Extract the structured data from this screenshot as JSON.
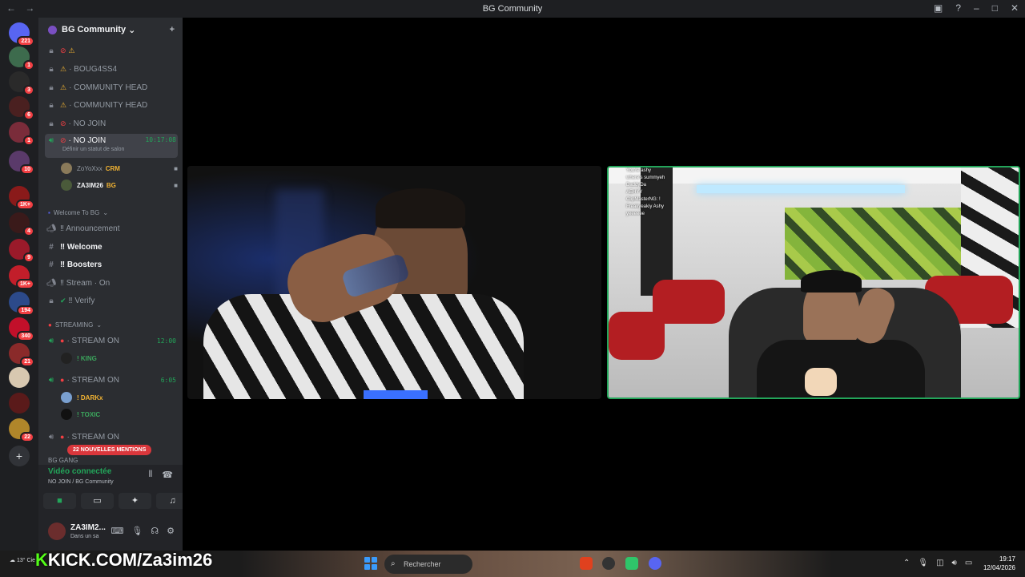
{
  "titlebar": {
    "title": "BG Community",
    "back": "←",
    "forward": "→"
  },
  "servers": [
    {
      "badge": "221"
    },
    {
      "badge": "1"
    },
    {
      "badge": "3"
    },
    {
      "badge": "6"
    },
    {
      "badge": "1"
    },
    {
      "badge": "10"
    },
    {
      "badge": "1K+"
    },
    {
      "badge": "4"
    },
    {
      "badge": "9"
    },
    {
      "badge": "1K+"
    },
    {
      "badge": "194"
    },
    {
      "badge": "340"
    },
    {
      "badge": "21"
    },
    {
      "badge": ""
    },
    {
      "badge": ""
    },
    {
      "badge": "22"
    }
  ],
  "guild": {
    "name": "BG Community"
  },
  "channels": [
    {
      "name": "·",
      "kind": "warn"
    },
    {
      "name": "· BOUG4SS4",
      "kind": "warn"
    },
    {
      "name": "· COMMUNITY HEAD",
      "kind": "warn"
    },
    {
      "name": "· COMMUNITY HEAD",
      "kind": "warn"
    },
    {
      "name": "· NO JOIN",
      "kind": "nojoin"
    }
  ],
  "active_channel": {
    "name": "· NO JOIN",
    "time": "10:17:08",
    "status": "Définir un statut de salon"
  },
  "voice_users_1": [
    {
      "name": "ZoYoXxx",
      "tag": "CRM"
    },
    {
      "name": "ZA3IM26",
      "tag": "BG"
    }
  ],
  "category_welcome": "Welcome To BG",
  "welcome_channels": [
    {
      "name": "‼ Announcement",
      "bold": false
    },
    {
      "name": "‼ Welcome",
      "bold": true
    },
    {
      "name": "‼ Boosters",
      "bold": true
    },
    {
      "name": "‼ Stream · On",
      "bold": false
    },
    {
      "name": "‼ Verify",
      "bold": false
    }
  ],
  "category_streaming": "STREAMING",
  "stream_channels": [
    {
      "name": "· STREAM ON",
      "time": "12:00"
    },
    {
      "name": "· STREAM ON",
      "time": "6:05"
    },
    {
      "name": "· STREAM ON",
      "time": ""
    }
  ],
  "stream_users": [
    {
      "name": "! KING"
    },
    {
      "name": "! DARKx"
    },
    {
      "name": "! TOXIC"
    }
  ],
  "category_bg_gang": "BG GANG",
  "mentions_banner": "22 NOUVELLES MENTIONS",
  "voice_panel": {
    "status": "Vidéo connectée",
    "location": "NO JOIN / BG Community"
  },
  "user_panel": {
    "name": "ZA3IM2...",
    "status": "Dans un sa"
  },
  "overlay": {
    "kick_prefix": "K",
    "kick_text": "KICK.COM/Za3im26"
  },
  "taskbar": {
    "search_placeholder": "Rechercher",
    "weather": "13°",
    "weather_sub": "Cie",
    "time": "19:17",
    "date": "12/04/2026"
  },
  "stream_chat": [
    "You're ashy",
    "where's summyeh",
    "DaddyDa",
    "AEHYY",
    "ClipMasterNG: !",
    "Freakyeakiy Ashy",
    "yeeeeee"
  ],
  "colors": {
    "accent_green": "#23a55a",
    "danger": "#f23f43",
    "warn": "#f0b232",
    "kick_green": "#53fc18"
  }
}
